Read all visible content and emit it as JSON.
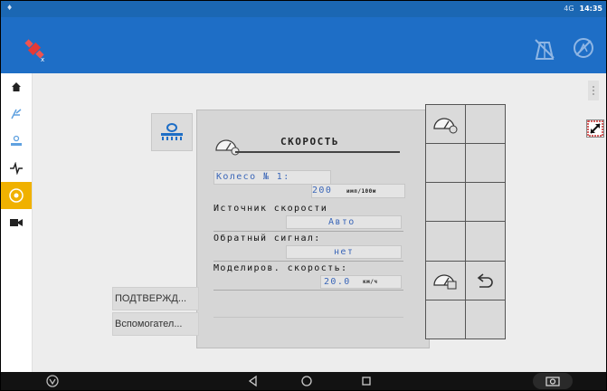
{
  "status_bar": {
    "time": "14:35",
    "signal": "4G"
  },
  "panel": {
    "title": "СКОРОСТЬ",
    "wheel_label": "Колесо № 1:",
    "wheel_value": "200",
    "wheel_unit": "имп/100м",
    "speed_source_label": "Источник скорости",
    "speed_source_value": "Авто",
    "feedback_label": "Обратный сигнал:",
    "feedback_value": "нет",
    "sim_label": "Моделиров. скорость:",
    "sim_value": "20.0",
    "sim_unit": "км/ч"
  },
  "buttons": {
    "confirm": "ПОДТВЕРЖД...",
    "auxiliary": "Вспомогател..."
  },
  "colors": {
    "accent_blue": "#1e6ec6",
    "sidebar_active": "#f0b100",
    "field_text": "#3a66b8"
  },
  "icons": {
    "sidebar": [
      "home-icon",
      "guidance-icon",
      "implement-icon",
      "diagnostics-icon",
      "speed-settings-icon",
      "camera-icon"
    ],
    "grid": [
      "speedometer-settings-icon",
      "speedometer-calibrate-icon",
      "back-arrow-icon"
    ]
  }
}
